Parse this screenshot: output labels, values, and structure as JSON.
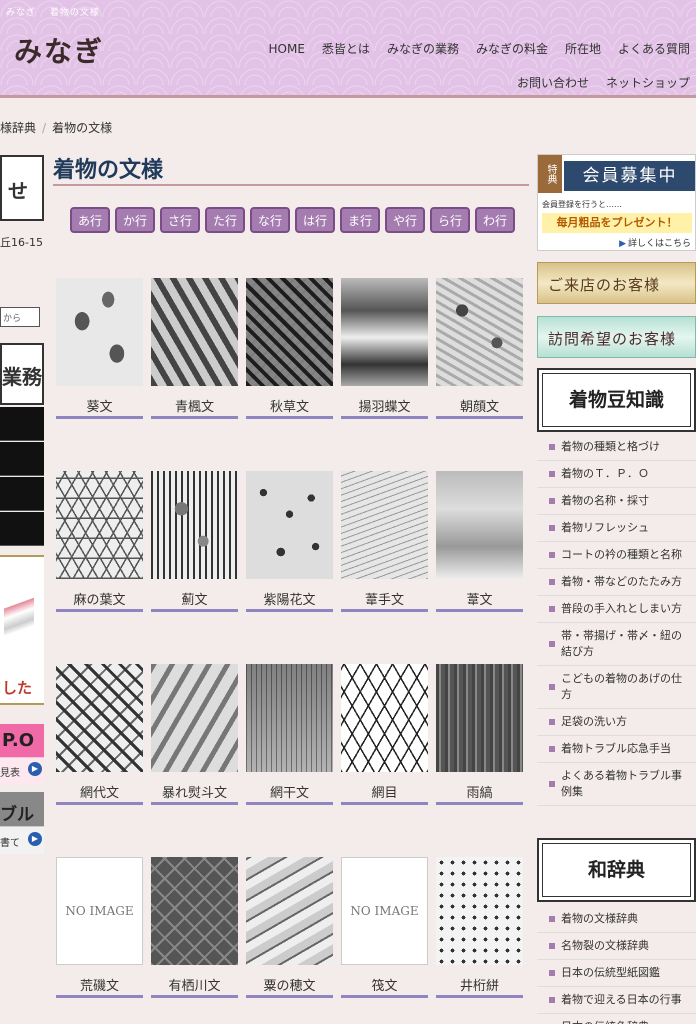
{
  "header": {
    "sub_title": "みなぎ 　着物の文様",
    "logo": "みなぎ",
    "nav": [
      "HOME",
      "悉皆とは",
      "みなぎの業務",
      "みなぎの料金",
      "所在地",
      "よくある質問",
      "お問い合わせ",
      "ネットショップ"
    ]
  },
  "breadcrumb": [
    "様辞典",
    "着物の文様"
  ],
  "left": {
    "box1": "せ",
    "address": "丘16-15",
    "input_text": "から",
    "box2": "業務",
    "box3_text": "した",
    "tpo": "P.O",
    "tpo_sub": "見表",
    "trouble": "ブル",
    "trouble_sub": "書て"
  },
  "main": {
    "title": "着物の文様",
    "kana": [
      "あ行",
      "か行",
      "さ行",
      "た行",
      "な行",
      "は行",
      "ま行",
      "や行",
      "ら行",
      "わ行"
    ],
    "items": [
      {
        "label": "葵文",
        "pattern": "aoi"
      },
      {
        "label": "青楓文",
        "pattern": "aokaede"
      },
      {
        "label": "秋草文",
        "pattern": "akikusa"
      },
      {
        "label": "揚羽蝶文",
        "pattern": "ageha"
      },
      {
        "label": "朝顔文",
        "pattern": "asagao"
      },
      {
        "label": "麻の葉文",
        "pattern": "asanoha"
      },
      {
        "label": "薊文",
        "pattern": "azami"
      },
      {
        "label": "紫陽花文",
        "pattern": "ajisai"
      },
      {
        "label": "葦手文",
        "pattern": "ashide"
      },
      {
        "label": "葦文",
        "pattern": "ashi"
      },
      {
        "label": "網代文",
        "pattern": "ajiro"
      },
      {
        "label": "暴れ熨斗文",
        "pattern": "abare"
      },
      {
        "label": "網干文",
        "pattern": "amiboshi"
      },
      {
        "label": "網目",
        "pattern": "amime"
      },
      {
        "label": "雨縞",
        "pattern": "amajima"
      },
      {
        "label": "荒磯文",
        "pattern": "noimg"
      },
      {
        "label": "有栖川文",
        "pattern": "arisugawa"
      },
      {
        "label": "粟の穂文",
        "pattern": "awanoho"
      },
      {
        "label": "筏文",
        "pattern": "noimg"
      },
      {
        "label": "井桁絣",
        "pattern": "igeta"
      }
    ],
    "noimage_text": "NO IMAGE"
  },
  "right": {
    "member": {
      "tag": "特典",
      "title": "会員募集中",
      "sub": "会員登録を行うと……",
      "gift": "毎月粗品をプレゼント！",
      "more": "詳しくはこちら"
    },
    "visit_store": "ご来店のお客様",
    "visit_request": "訪問希望のお客様",
    "mame_title": "着物豆知識",
    "mame_items": [
      "着物の種類と格づけ",
      "着物のＴ．Ｐ．Ｏ",
      "着物の名称・採寸",
      "着物リフレッシュ",
      "コートの衿の種類と名称",
      "着物・帯などのたたみ方",
      "普段の手入れとしまい方",
      "帯・帯揚げ・帯〆・紐の結び方",
      "こどもの着物のあげの仕方",
      "足袋の洗い方",
      "着物トラブル応急手当",
      "よくある着物トラブル事例集"
    ],
    "wajiten_title": "和辞典",
    "wajiten_items": [
      "着物の文様辞典",
      "名物裂の文様辞典",
      "日本の伝統型紙図鑑",
      "着物で迎える日本の行事",
      "日本の伝統色辞典"
    ]
  }
}
